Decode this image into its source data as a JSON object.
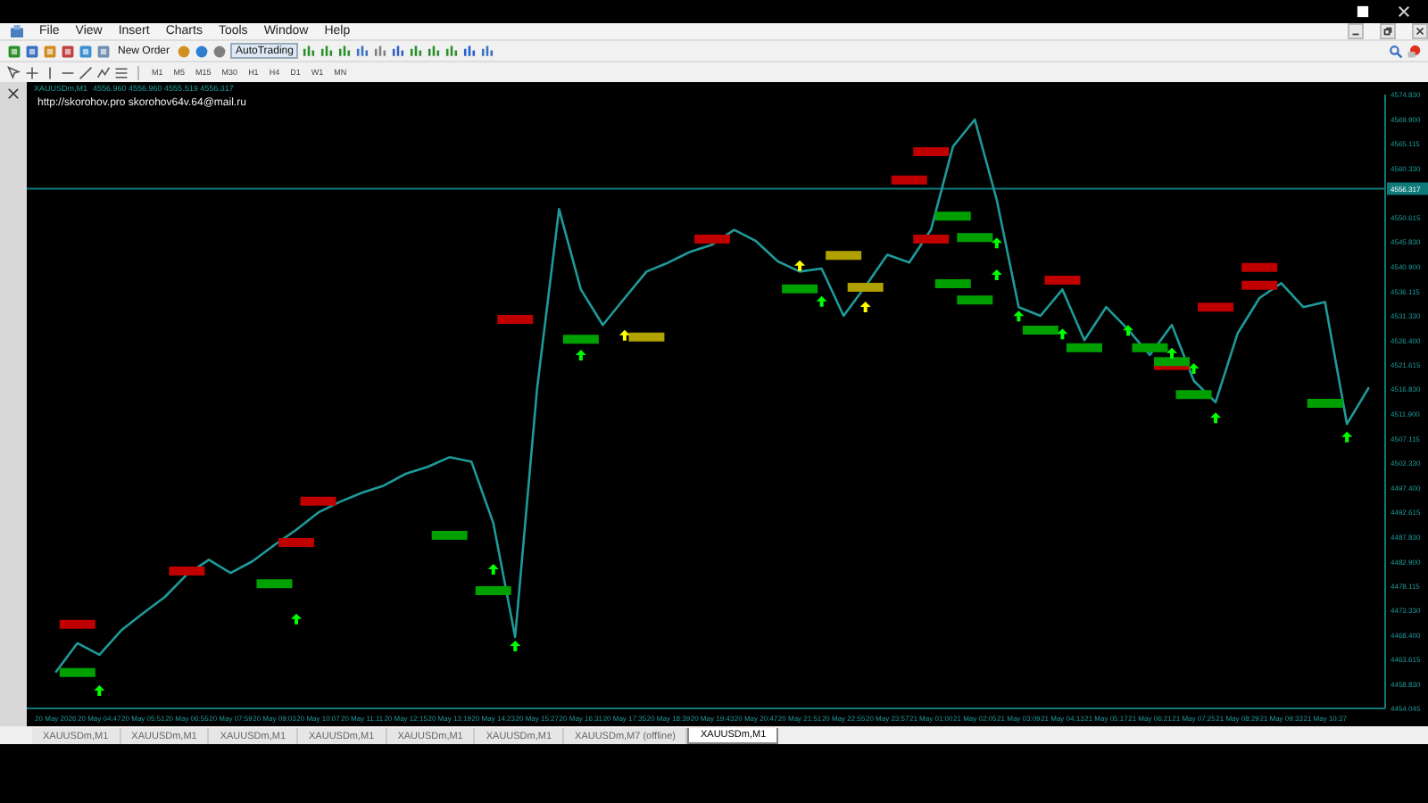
{
  "menu": [
    "File",
    "View",
    "Insert",
    "Charts",
    "Tools",
    "Window",
    "Help"
  ],
  "toolbar": {
    "buttons": [
      "New Order",
      "AutoTrading"
    ]
  },
  "timeframes": [
    "M1",
    "M5",
    "M15",
    "M30",
    "H1",
    "H4",
    "D1",
    "W1",
    "MN"
  ],
  "chart": {
    "ohlc": "4556.960 4556.960 4555.519 4556.317",
    "comment": "http://skorohov.pro   skorohov64v.64@mail.ru",
    "chart_data": {
      "type": "line",
      "ylim": [
        4454.045,
        4574.83
      ],
      "categories": [
        "20 May 2026",
        null,
        "20 May 04:47",
        null,
        "20 May 05:51",
        null,
        "20 May 06:55",
        null,
        "20 May 07:59",
        null,
        "20 May 09:03",
        null,
        "20 May 10:07",
        null,
        "20 May 11:11",
        null,
        "20 May 12:15",
        null,
        "20 May 13:19",
        null,
        "20 May 14:23",
        null,
        "20 May 15:27",
        null,
        "20 May 16:31",
        null,
        "20 May 17:35",
        null,
        "20 May 18:39",
        null,
        "20 May 19:43",
        null,
        "20 May 20:47",
        null,
        "20 May 21:51",
        null,
        "20 May 22:55",
        null,
        "20 May 23:57",
        null,
        "21 May 01:00",
        null,
        "21 May 02:05",
        null,
        "21 May 03:09",
        null,
        "21 May 04:13",
        null,
        "21 May 05:17",
        null,
        "21 May 06:21",
        null,
        "21 May 07:25",
        null,
        "21 May 08:29",
        null,
        "21 May 09:33",
        null,
        "21 May 10:37",
        null,
        null
      ],
      "series": [
        {
          "name": "XAUUSDm,M1",
          "color": "#1f9a9a",
          "values": [
            4461.1,
            4466.9,
            4464.6,
            4469.4,
            4472.8,
            4476.0,
            4480.4,
            4483.3,
            4480.7,
            4483.0,
            4486.2,
            4489.2,
            4492.6,
            4494.7,
            4496.5,
            4497.9,
            4500.2,
            4501.6,
            4503.5,
            4502.6,
            4490.5,
            4468.1,
            4517.0,
            4552.3,
            4536.5,
            4529.5,
            4534.8,
            4540.0,
            4541.8,
            4543.9,
            4545.3,
            4548.2,
            4546.0,
            4542.0,
            4540.0,
            4540.6,
            4531.3,
            4537.1,
            4543.3,
            4541.8,
            4548.3,
            4564.6,
            4569.9,
            4554.1,
            4533.0,
            4531.3,
            4536.5,
            4526.5,
            4533.0,
            4528.6,
            4523.6,
            4529.5,
            4518.5,
            4514.3,
            4527.8,
            4534.8,
            4537.7,
            4533.0,
            4534.0,
            4510.0,
            4517.2
          ]
        }
      ],
      "ref_lines": [
        {
          "axis": "y",
          "value": 4556.317,
          "label": "4556.317",
          "color": "#0f7a7a"
        }
      ],
      "yticks": [
        {
          "value": 4574.83,
          "label": "4574.830"
        },
        {
          "value": 4569.9,
          "label": "4569.900"
        },
        4565.115,
        {
          "value": 4560.33,
          "label": "4560.330"
        },
        4550.615,
        {
          "value": 4545.83,
          "label": "4545.830"
        },
        {
          "value": 4540.9,
          "label": "4540.900"
        },
        4536.115,
        {
          "value": 4531.33,
          "label": "4531.330"
        },
        {
          "value": 4526.4,
          "label": "4526.400"
        },
        4521.615,
        {
          "value": 4516.83,
          "label": "4516.830"
        },
        {
          "value": 4511.9,
          "label": "4511.900"
        },
        4507.115,
        {
          "value": 4502.33,
          "label": "4502.330"
        },
        {
          "value": 4497.4,
          "label": "4497.400"
        },
        4492.615,
        {
          "value": 4487.83,
          "label": "4487.830"
        },
        {
          "value": 4482.9,
          "label": "4482.900"
        },
        4478.115,
        {
          "value": 4473.33,
          "label": "4473.330"
        },
        {
          "value": 4468.4,
          "label": "4468.400"
        },
        4463.615,
        {
          "value": 4458.83,
          "label": "4458.830"
        },
        4454.045
      ]
    }
  },
  "tabs": [
    {
      "label": "XAUUSDm,M1",
      "selected": false
    },
    {
      "label": "XAUUSDm,M1",
      "selected": false
    },
    {
      "label": "XAUUSDm,M1",
      "selected": false
    },
    {
      "label": "XAUUSDm,M1",
      "selected": false
    },
    {
      "label": "XAUUSDm,M1",
      "selected": false
    },
    {
      "label": "XAUUSDm,M1",
      "selected": false
    },
    {
      "label": "XAUUSDm,M7 (offline)",
      "selected": false
    },
    {
      "label": "XAUUSDm,M1",
      "selected": true
    }
  ]
}
